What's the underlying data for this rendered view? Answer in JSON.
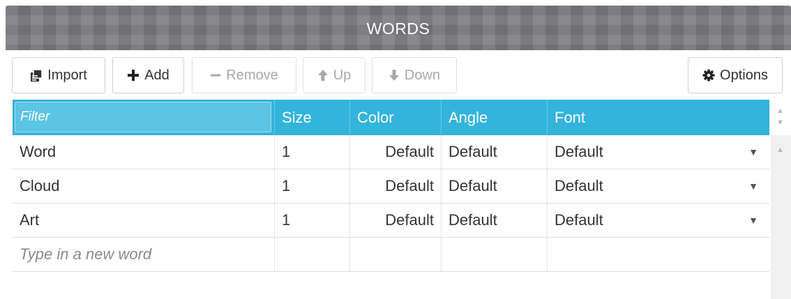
{
  "header": {
    "title": "WORDS"
  },
  "toolbar": {
    "import_label": "Import",
    "add_label": "Add",
    "remove_label": "Remove",
    "up_label": "Up",
    "down_label": "Down",
    "options_label": "Options",
    "icons": {
      "import": "import-icon",
      "add": "plus-icon",
      "remove": "minus-icon",
      "up": "arrow-up-icon",
      "down": "arrow-down-icon",
      "options": "gear-icon"
    }
  },
  "grid": {
    "filter_placeholder": "Filter",
    "columns": [
      "Size",
      "Color",
      "Angle",
      "Font"
    ],
    "rows": [
      {
        "word": "Word",
        "size": "1",
        "color": "Default",
        "angle": "Default",
        "font": "Default"
      },
      {
        "word": "Cloud",
        "size": "1",
        "color": "Default",
        "angle": "Default",
        "font": "Default"
      },
      {
        "word": "Art",
        "size": "1",
        "color": "Default",
        "angle": "Default",
        "font": "Default"
      }
    ],
    "new_word_placeholder": "Type in a new word"
  },
  "colors": {
    "header_bg": "#7b7a80",
    "grid_header_bg": "#33b4dc",
    "disabled_text": "#a8a8a8"
  }
}
